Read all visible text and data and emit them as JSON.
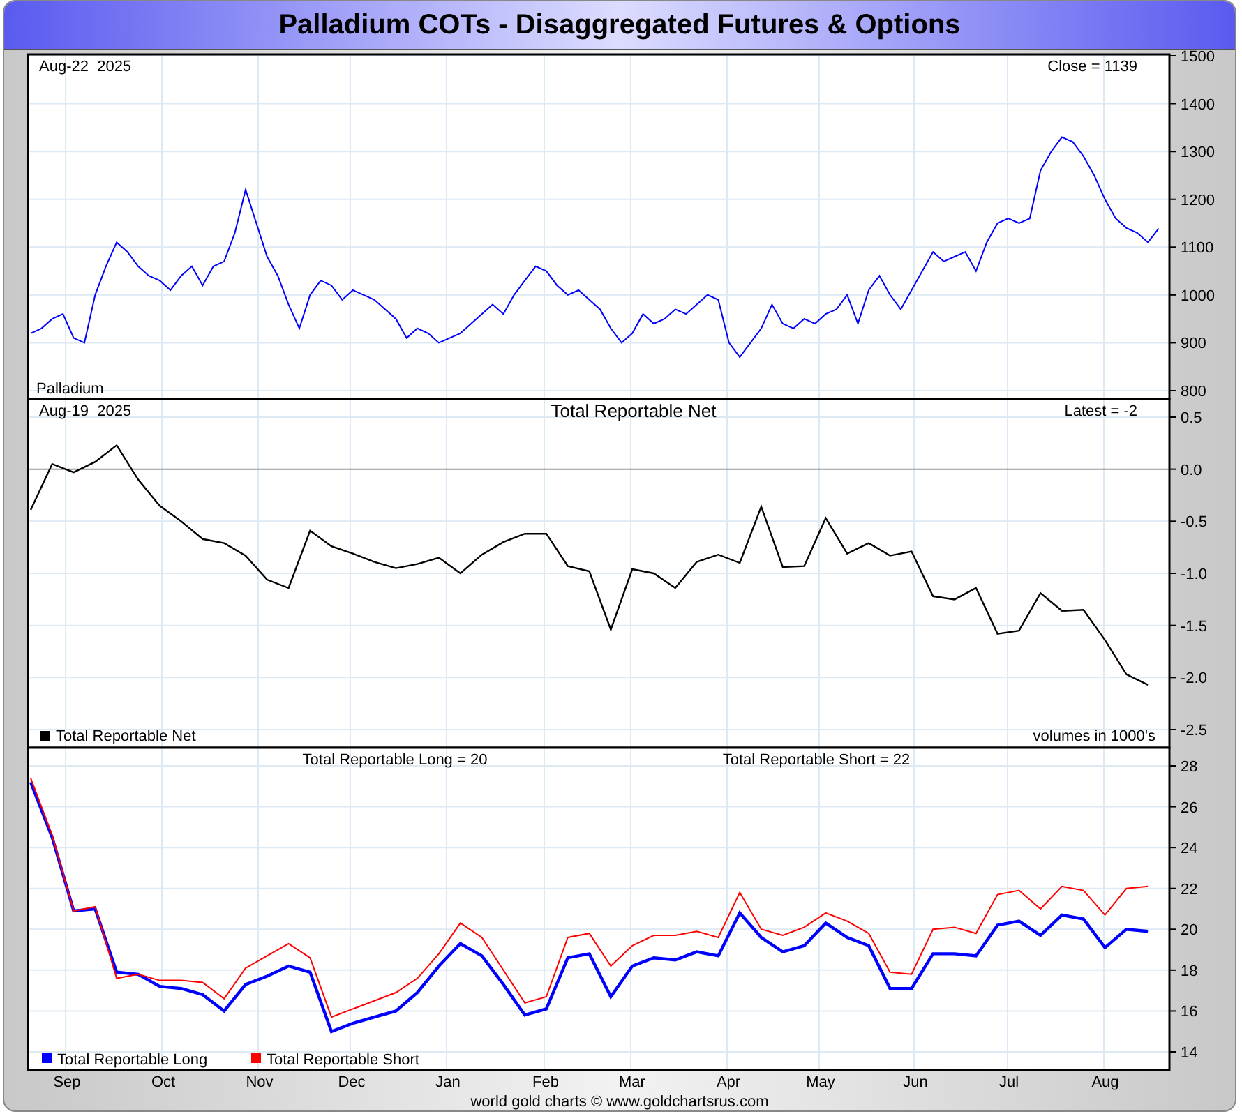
{
  "window": {
    "title": "Palladium COTs - Disaggregated Futures & Options"
  },
  "price_panel": {
    "date": "Aug-22  2025",
    "reading": "Close = 1139",
    "chart_data": {
      "type": "line",
      "grid": true,
      "legend": true,
      "ylim": [
        800,
        1500
      ],
      "yticks": [
        800,
        900,
        1000,
        1100,
        1200,
        1300,
        1400,
        1500
      ],
      "series": [
        {
          "name": "Palladium",
          "color": "#0000ff",
          "values": [
            920,
            930,
            950,
            960,
            910,
            900,
            1000,
            1060,
            1110,
            1090,
            1060,
            1040,
            1030,
            1010,
            1040,
            1060,
            1020,
            1060,
            1070,
            1130,
            1220,
            1150,
            1080,
            1040,
            980,
            930,
            1000,
            1030,
            1020,
            990,
            1010,
            1000,
            990,
            970,
            950,
            910,
            930,
            920,
            900,
            910,
            920,
            940,
            960,
            980,
            960,
            1000,
            1030,
            1060,
            1050,
            1020,
            1000,
            1010,
            990,
            970,
            930,
            900,
            920,
            960,
            940,
            950,
            970,
            960,
            980,
            1000,
            990,
            900,
            870,
            900,
            930,
            980,
            940,
            930,
            950,
            940,
            960,
            970,
            1000,
            940,
            1010,
            1040,
            1000,
            970,
            1010,
            1050,
            1090,
            1070,
            1080,
            1090,
            1050,
            1110,
            1150,
            1160,
            1150,
            1160,
            1260,
            1300,
            1330,
            1320,
            1290,
            1250,
            1200,
            1160,
            1140,
            1130,
            1110,
            1139
          ]
        }
      ]
    }
  },
  "net_panel": {
    "date": "Aug-19  2025",
    "reading": "Latest = -2",
    "note": "volumes in 1000's",
    "chart_data": {
      "type": "line",
      "title": "Total Reportable Net",
      "grid": true,
      "legend": true,
      "ylim": [
        -2.5,
        0.5
      ],
      "yticks": [
        {
          "value": -2.5,
          "label": "-2.5"
        },
        {
          "value": -2,
          "label": "-2.0"
        },
        {
          "value": -1.5,
          "label": "-1.5"
        },
        {
          "value": -1,
          "label": "-1.0"
        },
        {
          "value": -0.5,
          "label": "-0.5"
        },
        {
          "value": 0,
          "label": "0.0"
        },
        {
          "value": 0.5,
          "label": "0.5"
        }
      ],
      "series": [
        {
          "name": "Total Reportable Net",
          "color": "#000000",
          "values": [
            -0.39,
            0.05,
            -0.03,
            0.07,
            0.23,
            -0.1,
            -0.35,
            -0.5,
            -0.67,
            -0.71,
            -0.83,
            -1.06,
            -1.14,
            -0.59,
            -0.74,
            -0.81,
            -0.89,
            -0.95,
            -0.91,
            -0.85,
            -1.0,
            -0.82,
            -0.7,
            -0.62,
            -0.62,
            -0.93,
            -0.98,
            -1.54,
            -0.96,
            -1.0,
            -1.14,
            -0.89,
            -0.82,
            -0.9,
            -0.36,
            -0.94,
            -0.93,
            -0.47,
            -0.81,
            -0.71,
            -0.83,
            -0.79,
            -1.22,
            -1.25,
            -1.14,
            -1.58,
            -1.55,
            -1.19,
            -1.36,
            -1.35,
            -1.64,
            -1.97,
            -2.07
          ]
        }
      ]
    }
  },
  "positions_panel": {
    "long_reading": "Total Reportable Long = 20",
    "short_reading": "Total Reportable Short = 22",
    "chart_data": {
      "type": "line",
      "grid": true,
      "legend": true,
      "ylim": [
        14,
        28
      ],
      "yticks": [
        14,
        16,
        18,
        20,
        22,
        24,
        26,
        28
      ],
      "series": [
        {
          "name": "Total Reportable Long",
          "color": "#0000ff",
          "values": [
            27.2,
            24.5,
            20.9,
            21.0,
            17.9,
            17.8,
            17.2,
            17.1,
            16.8,
            16.0,
            17.3,
            17.7,
            18.2,
            17.9,
            15.0,
            15.4,
            15.7,
            16.0,
            16.9,
            18.2,
            19.3,
            18.7,
            17.3,
            15.8,
            16.1,
            18.6,
            18.8,
            16.7,
            18.2,
            18.6,
            18.5,
            18.9,
            18.7,
            20.8,
            19.6,
            18.9,
            19.2,
            20.3,
            19.6,
            19.2,
            17.1,
            17.1,
            18.8,
            18.8,
            18.7,
            20.2,
            20.4,
            19.7,
            20.7,
            20.5,
            19.1,
            20.0,
            19.9
          ]
        },
        {
          "name": "Total Reportable Short",
          "color": "#ff0000",
          "values": [
            27.4,
            24.6,
            20.9,
            21.1,
            17.6,
            17.8,
            17.5,
            17.5,
            17.4,
            16.6,
            18.1,
            18.7,
            19.3,
            18.6,
            15.7,
            16.1,
            16.5,
            16.9,
            17.6,
            18.8,
            20.3,
            19.6,
            18.0,
            16.4,
            16.7,
            19.6,
            19.8,
            18.2,
            19.2,
            19.7,
            19.7,
            19.9,
            19.6,
            21.8,
            20.0,
            19.7,
            20.1,
            20.8,
            20.4,
            19.8,
            17.9,
            17.8,
            20.0,
            20.1,
            19.8,
            21.7,
            21.9,
            21.0,
            22.1,
            21.9,
            20.7,
            22.0,
            22.1
          ]
        }
      ]
    }
  },
  "month_labels": [
    "Sep",
    "Oct",
    "Nov",
    "Dec",
    "Jan",
    "Feb",
    "Mar",
    "Apr",
    "May",
    "Jun",
    "Jul",
    "Aug"
  ],
  "footer": "world gold charts © www.goldchartsrus.com"
}
